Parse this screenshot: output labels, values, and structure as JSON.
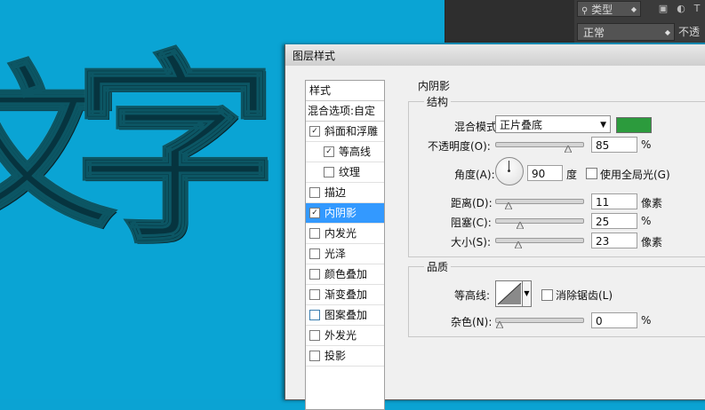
{
  "canvas": {
    "glyphs": [
      "文",
      "字"
    ]
  },
  "layers_panel": {
    "filter_label": "类型",
    "blend_mode": "正常",
    "opacity_label": "不透",
    "icons": [
      "search-icon",
      "chevron-icon",
      "image-filter-icon",
      "circle-filter-icon",
      "type-filter-icon"
    ]
  },
  "dialog": {
    "title": "图层样式",
    "styles_list": {
      "header": "样式",
      "blend_options": "混合选项:自定",
      "items": [
        {
          "label": "斜面和浮雕",
          "checked": true,
          "sub": false,
          "active": false
        },
        {
          "label": "等高线",
          "checked": true,
          "sub": true,
          "active": false
        },
        {
          "label": "纹理",
          "checked": false,
          "sub": true,
          "active": false
        },
        {
          "label": "描边",
          "checked": false,
          "sub": false,
          "active": false
        },
        {
          "label": "内阴影",
          "checked": true,
          "sub": false,
          "active": true
        },
        {
          "label": "内发光",
          "checked": false,
          "sub": false,
          "active": false
        },
        {
          "label": "光泽",
          "checked": false,
          "sub": false,
          "active": false
        },
        {
          "label": "颜色叠加",
          "checked": false,
          "sub": false,
          "active": false
        },
        {
          "label": "渐变叠加",
          "checked": false,
          "sub": false,
          "active": false
        },
        {
          "label": "图案叠加",
          "checked": false,
          "sub": false,
          "active": false
        },
        {
          "label": "外发光",
          "checked": false,
          "sub": false,
          "active": false
        },
        {
          "label": "投影",
          "checked": false,
          "sub": false,
          "active": false
        }
      ]
    },
    "inner_shadow": {
      "section_title": "内阴影",
      "structure_title": "结构",
      "blend_mode_label": "混合模式(B):",
      "blend_mode_value": "正片叠底",
      "color": "#2c9b3d",
      "opacity_label": "不透明度(O):",
      "opacity_value": "85",
      "opacity_unit": "%",
      "angle_label": "角度(A):",
      "angle_value": "90",
      "angle_unit": "度",
      "global_light_label": "使用全局光(G)",
      "global_light_checked": false,
      "distance_label": "距离(D):",
      "distance_value": "11",
      "distance_unit": "像素",
      "choke_label": "阻塞(C):",
      "choke_value": "25",
      "choke_unit": "%",
      "size_label": "大小(S):",
      "size_value": "23",
      "size_unit": "像素",
      "quality_title": "品质",
      "contour_label": "等高线:",
      "antialias_label": "消除锯齿(L)",
      "antialias_checked": false,
      "noise_label": "杂色(N):",
      "noise_value": "0",
      "noise_unit": "%"
    },
    "slider_levels": {
      "opacity": 0.85,
      "distance": 0.11,
      "choke": 0.25,
      "size": 0.23,
      "noise": 0.0
    }
  }
}
